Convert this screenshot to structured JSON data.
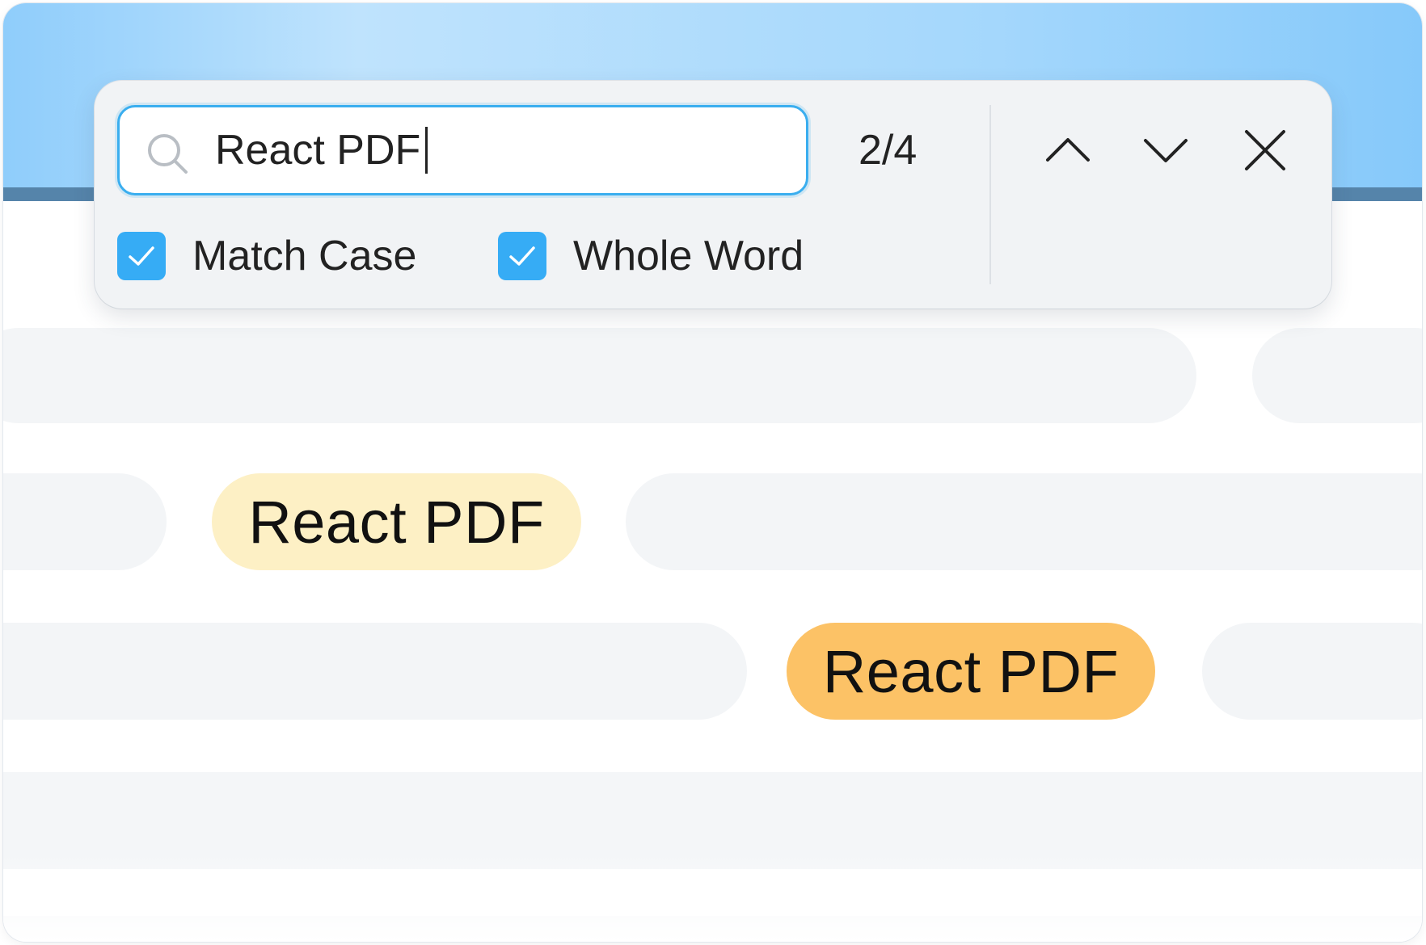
{
  "search": {
    "query": "React PDF",
    "match_count": "2/4"
  },
  "options": [
    {
      "label": "Match Case",
      "checked": true
    },
    {
      "label": "Whole Word",
      "checked": true
    }
  ],
  "controls": {
    "previous_icon": "chevron-up-icon",
    "next_icon": "chevron-down-icon",
    "close_icon": "close-icon"
  },
  "highlights": [
    {
      "text": "React PDF",
      "state": "match"
    },
    {
      "text": "React PDF",
      "state": "current-match"
    }
  ],
  "colors": {
    "accent": "#36acf5",
    "match_highlight": "#fdf0c5",
    "current_match_highlight": "#fcc266",
    "header_gradient": "#a4d7fc"
  }
}
